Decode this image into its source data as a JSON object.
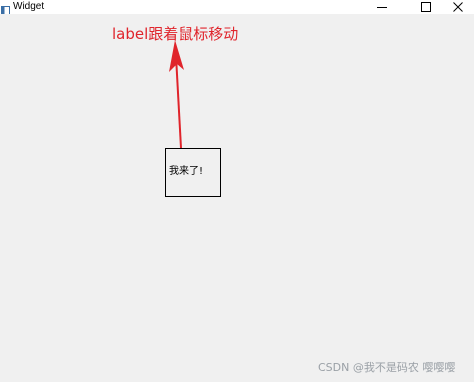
{
  "window": {
    "title": "Widget",
    "controls": {
      "minimize": "minimize-icon",
      "maximize": "maximize-icon",
      "close": "close-icon"
    }
  },
  "annotation": {
    "text": "label跟着鼠标移动",
    "color": "#e0242b"
  },
  "follow_label": {
    "text": "我来了!"
  },
  "watermark": {
    "text": "CSDN @我不是码农 嘤嘤嘤"
  },
  "colors": {
    "client_bg": "#f0f0f0",
    "titlebar_bg": "#ffffff",
    "arrow": "#e0242b"
  }
}
